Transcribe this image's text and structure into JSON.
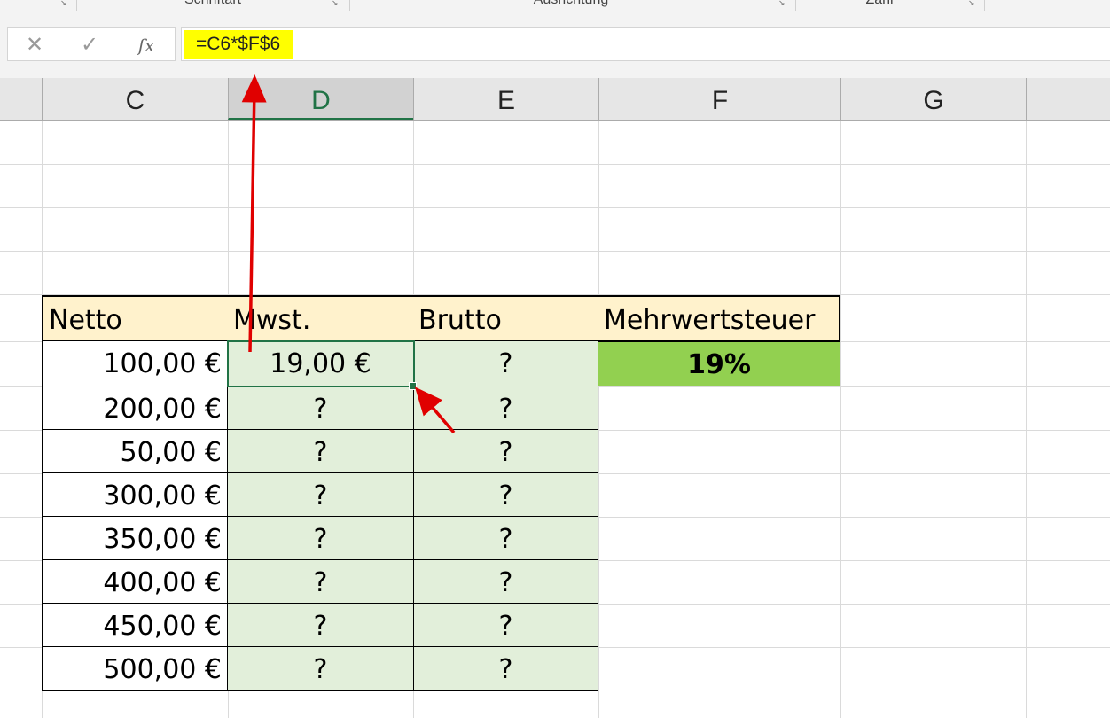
{
  "ribbon": {
    "groups": [
      {
        "label": "Schriftart"
      },
      {
        "label": "Ausrichtung"
      },
      {
        "label": "Zahl"
      }
    ]
  },
  "formula_bar": {
    "cancel_icon": "cancel-x-icon",
    "enter_icon": "checkmark-icon",
    "insert_function_label": "fx",
    "formula": "=C6*$F$6"
  },
  "columns": [
    {
      "label": "C"
    },
    {
      "label": "D",
      "selected": true
    },
    {
      "label": "E"
    },
    {
      "label": "F"
    },
    {
      "label": "G"
    }
  ],
  "table": {
    "headers": {
      "netto": "Netto",
      "mwst": "Mwst.",
      "brutto": "Brutto",
      "mehrwertsteuer": "Mehrwertsteuer"
    },
    "rows": [
      {
        "netto": "100,00 €",
        "mwst": "19,00 €",
        "brutto": "?"
      },
      {
        "netto": "200,00 €",
        "mwst": "?",
        "brutto": "?"
      },
      {
        "netto": "50,00 €",
        "mwst": "?",
        "brutto": "?"
      },
      {
        "netto": "300,00 €",
        "mwst": "?",
        "brutto": "?"
      },
      {
        "netto": "350,00 €",
        "mwst": "?",
        "brutto": "?"
      },
      {
        "netto": "400,00 €",
        "mwst": "?",
        "brutto": "?"
      },
      {
        "netto": "450,00 €",
        "mwst": "?",
        "brutto": "?"
      },
      {
        "netto": "500,00 €",
        "mwst": "?",
        "brutto": "?"
      }
    ],
    "tax_rate": "19%"
  },
  "colors": {
    "header_fill": "#fff2cc",
    "formula_highlight": "#ffff00",
    "result_fill": "#e2efda",
    "rate_fill": "#92d050",
    "selection": "#217346",
    "annotation_arrow": "#e00000"
  }
}
